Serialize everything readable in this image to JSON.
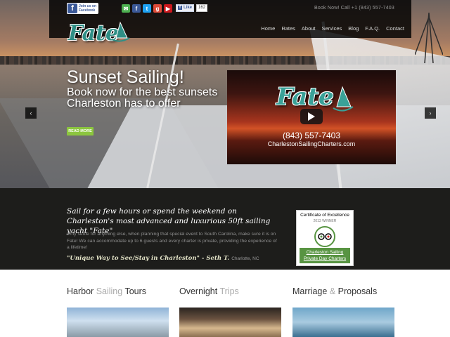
{
  "header": {
    "facebook_join": {
      "line1": "Join us on",
      "line2": "Facebook"
    },
    "social_icons": [
      "share-icon",
      "facebook-icon",
      "twitter-icon",
      "google-plus-icon",
      "youtube-icon"
    ],
    "like_label": "Like",
    "like_count": "162",
    "book_now": "Book Now! Call +1 (843) 557-7403",
    "logo_text": "Fate",
    "nav": [
      "Home",
      "Rates",
      "About",
      "Services",
      "Blog",
      "F.A.Q.",
      "Contact"
    ]
  },
  "hero": {
    "title": "Sunset Sailing!",
    "subtitle": "Book now for the best sunsets Charleston has to offer",
    "read_more": "READ MORE",
    "prev_arrow": "‹",
    "next_arrow": "›",
    "video": {
      "logo_text": "Fate",
      "phone": "(843) 557-7403",
      "site": "CharlestonSailingCharters.com"
    }
  },
  "intro": {
    "tagline": "Sail for a few hours or spend the weekend on Charleston's most advanced and luxurious 50ft sailing yacht \"Fate\"",
    "body": "Why settle for anything else, when planning that special event to South Carolina, make sure it is on Fate! We can accommodate up to 6 guests and every charter is private, providing the experience of a lifetime!",
    "quote": "\"Unique Way to See/Stay in Charleston\" - Seth T.",
    "quote_location": "Charlotte, NC"
  },
  "certificate": {
    "title": "Certificate of Excellence",
    "year": "2013 WINNER",
    "link": "Charleston Sailing Private Day Charters"
  },
  "sections": [
    {
      "a": "Harbor ",
      "b": "Sailing",
      "c": " Tours"
    },
    {
      "a": "Overnight ",
      "b": "Trips",
      "c": ""
    },
    {
      "a": "Marriage ",
      "b": "&",
      "c": " Proposals"
    }
  ],
  "colors": {
    "accent_green": "#8cc63f",
    "teal_logo": "#2f8f86",
    "band_bg": "#1d1d1b"
  }
}
